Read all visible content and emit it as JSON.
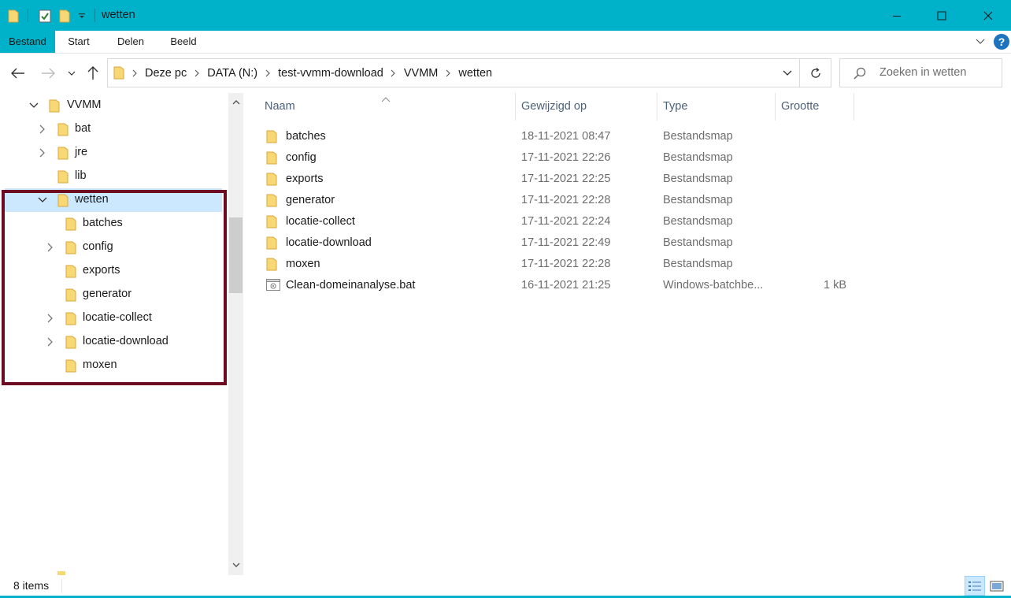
{
  "window": {
    "title": "wetten"
  },
  "ribbon": {
    "tabs": [
      "Bestand",
      "Start",
      "Delen",
      "Beeld"
    ],
    "help": "?"
  },
  "address": {
    "crumbs": [
      "Deze pc",
      "DATA (N:)",
      "test-vvmm-download",
      "VVMM",
      "wetten"
    ]
  },
  "search": {
    "placeholder": "Zoeken in wetten"
  },
  "tree": {
    "items": [
      {
        "label": "VVMM",
        "expander": "expanded"
      },
      {
        "label": "bat",
        "expander": "collapsed"
      },
      {
        "label": "jre",
        "expander": "collapsed"
      },
      {
        "label": "lib",
        "expander": "none"
      },
      {
        "label": "wetten",
        "expander": "expanded",
        "selected": true
      },
      {
        "label": "batches",
        "expander": "none"
      },
      {
        "label": "config",
        "expander": "collapsed"
      },
      {
        "label": "exports",
        "expander": "none"
      },
      {
        "label": "generator",
        "expander": "none"
      },
      {
        "label": "locatie-collect",
        "expander": "collapsed"
      },
      {
        "label": "locatie-download",
        "expander": "collapsed"
      },
      {
        "label": "moxen",
        "expander": "none"
      }
    ]
  },
  "columns": {
    "name": "Naam",
    "modified": "Gewijzigd op",
    "type": "Type",
    "size": "Grootte"
  },
  "files": [
    {
      "name": "batches",
      "modified": "18-11-2021 08:47",
      "type": "Bestandsmap",
      "size": "",
      "icon": "folder-icon"
    },
    {
      "name": "config",
      "modified": "17-11-2021 22:26",
      "type": "Bestandsmap",
      "size": "",
      "icon": "folder-icon"
    },
    {
      "name": "exports",
      "modified": "17-11-2021 22:25",
      "type": "Bestandsmap",
      "size": "",
      "icon": "folder-icon"
    },
    {
      "name": "generator",
      "modified": "17-11-2021 22:28",
      "type": "Bestandsmap",
      "size": "",
      "icon": "folder-icon"
    },
    {
      "name": "locatie-collect",
      "modified": "17-11-2021 22:24",
      "type": "Bestandsmap",
      "size": "",
      "icon": "folder-icon"
    },
    {
      "name": "locatie-download",
      "modified": "17-11-2021 22:49",
      "type": "Bestandsmap",
      "size": "",
      "icon": "folder-icon"
    },
    {
      "name": "moxen",
      "modified": "17-11-2021 22:28",
      "type": "Bestandsmap",
      "size": "",
      "icon": "folder-icon"
    },
    {
      "name": "Clean-domeinanalyse.bat",
      "modified": "16-11-2021 21:25",
      "type": "Windows-batchbe...",
      "size": "1 kB",
      "icon": "batch-file-icon"
    }
  ],
  "status": {
    "count": "8 items"
  },
  "colors": {
    "accent": "#00b2c9",
    "selection": "#cce8ff",
    "highlight_box": "#6e0a22",
    "folder": "#f8d775"
  }
}
